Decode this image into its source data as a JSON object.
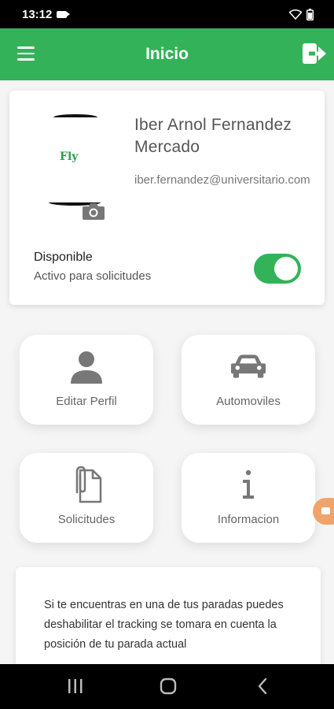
{
  "status_bar": {
    "time": "13:12"
  },
  "app_bar": {
    "title": "Inicio"
  },
  "profile": {
    "name": "Iber Arnol Fernandez Mercado",
    "email": "iber.fernandez@universitario.com",
    "avatar_logo_text": "Fly",
    "availability_label": "Disponible",
    "availability_sub": "Activo para solicitudes",
    "available": true
  },
  "tiles": [
    {
      "label": "Editar Perfil",
      "icon": "person-icon"
    },
    {
      "label": "Automoviles",
      "icon": "car-icon"
    },
    {
      "label": "Solicitudes",
      "icon": "attachment-icon"
    },
    {
      "label": "Informacion",
      "icon": "info-icon"
    }
  ],
  "info_text": "Si te encuentras en una de tus paradas puedes deshabilitar el tracking se tomara en cuenta la posición de tu parada actual",
  "colors": {
    "primary": "#34b25a",
    "overlay": "#f0a36a"
  }
}
